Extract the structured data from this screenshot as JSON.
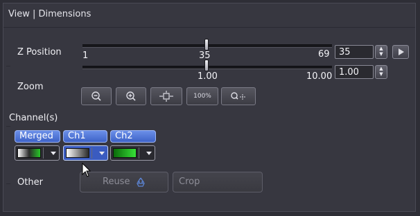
{
  "header": {
    "title": "View | Dimensions"
  },
  "z_position": {
    "label": "Z Position",
    "min_label": "1",
    "mid_label": "35",
    "max_label": "69",
    "value": "35",
    "play_icon": "play-icon"
  },
  "zoom": {
    "label": "Zoom",
    "min_label": "1.00",
    "max_label": "10.00",
    "value": "1.00",
    "tools": [
      {
        "icon": "zoom-out-icon"
      },
      {
        "icon": "zoom-in-icon"
      },
      {
        "icon": "fit-to-window-icon"
      },
      {
        "icon": "zoom-100-icon",
        "text": "100%"
      },
      {
        "icon": "zoom-region-icon"
      }
    ]
  },
  "channels": {
    "label": "Channel(s)",
    "tabs": [
      {
        "label": "Merged"
      },
      {
        "label": "Ch1"
      },
      {
        "label": "Ch2"
      }
    ],
    "luts": [
      {
        "name": "merged-lut",
        "colors": [
          "#ffffff",
          "#2a2a2a",
          "#28c828"
        ]
      },
      {
        "name": "ch1-lut",
        "colors": [
          "#ffffff",
          "#2a2a2a"
        ]
      },
      {
        "name": "ch2-lut",
        "colors": [
          "#0a6a0a",
          "#38e038"
        ]
      }
    ],
    "selected_lut": 1
  },
  "other": {
    "label": "Other",
    "reuse_label": "Reuse",
    "crop_label": "Crop"
  }
}
